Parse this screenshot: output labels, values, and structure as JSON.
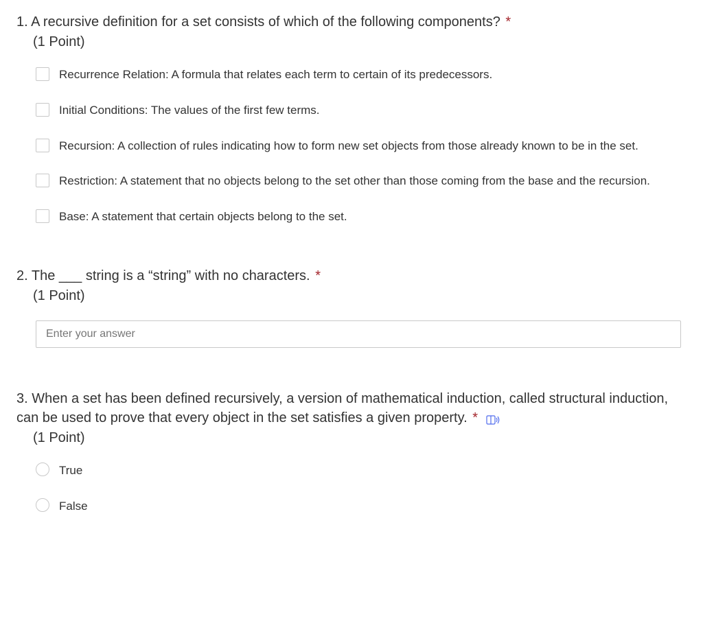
{
  "questions": [
    {
      "number": "1.",
      "text": "A recursive definition for a set consists of which of the following components?",
      "required_mark": "*",
      "points": "(1 Point)",
      "type": "checkbox",
      "options": [
        "Recurrence Relation: A formula that relates each term to certain of its predecessors.",
        "Initial Conditions: The values of the first few terms.",
        "Recursion: A collection of rules indicating how to form new set objects from those already known to be in the set.",
        "Restriction: A statement that no objects belong to the set other than those coming from the base and the recursion.",
        "Base: A statement that certain objects belong to the set."
      ]
    },
    {
      "number": "2.",
      "text": "The ___ string is a “string” with no characters.",
      "required_mark": "*",
      "points": "(1 Point)",
      "type": "text",
      "placeholder": "Enter your answer"
    },
    {
      "number": "3.",
      "text": "When a set has been defined recursively, a version of mathematical induction, called structural induction, can be used to prove that every object in the set satisfies a given property.",
      "required_mark": "*",
      "points": "(1 Point)",
      "type": "radio",
      "has_immersive_icon": true,
      "options": [
        "True",
        "False"
      ]
    }
  ]
}
